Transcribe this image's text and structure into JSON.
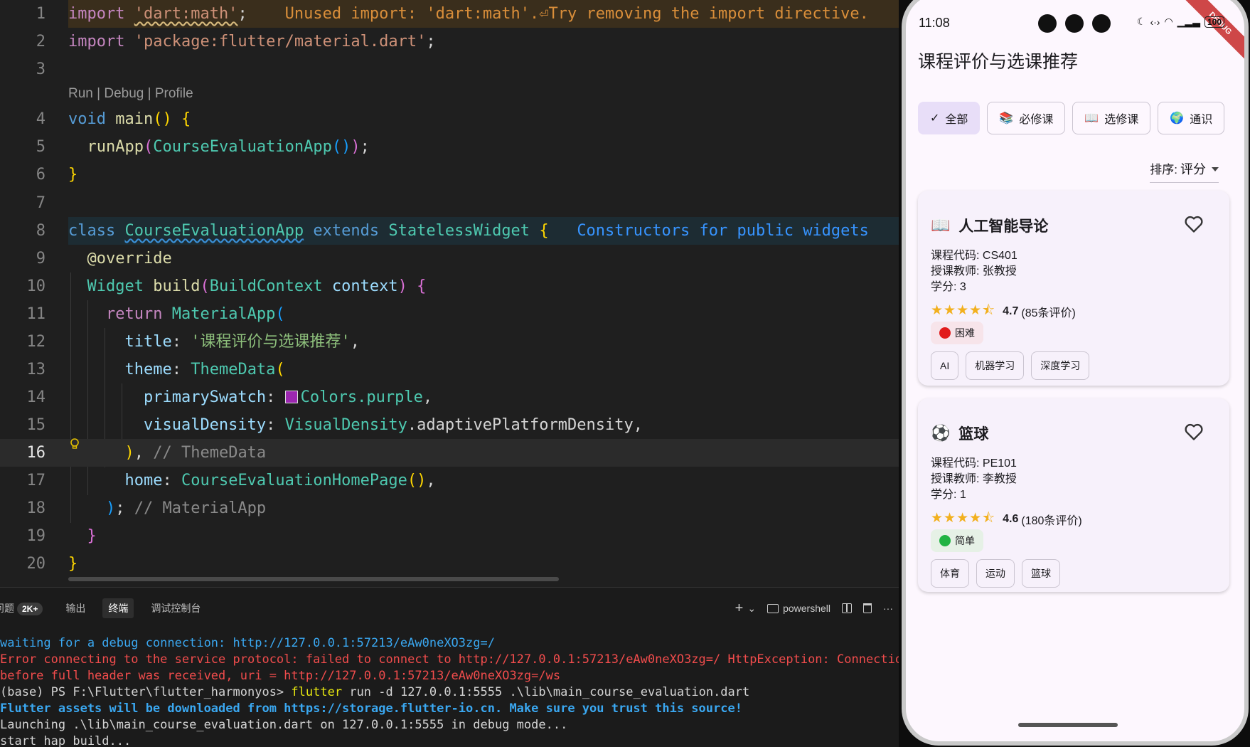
{
  "editor": {
    "lines": [
      {
        "n": "1"
      },
      {
        "n": "2"
      },
      {
        "n": "3"
      },
      {
        "n": "4"
      },
      {
        "n": "5"
      },
      {
        "n": "6"
      },
      {
        "n": "7"
      },
      {
        "n": "8"
      },
      {
        "n": "9"
      },
      {
        "n": "10"
      },
      {
        "n": "11"
      },
      {
        "n": "12"
      },
      {
        "n": "13"
      },
      {
        "n": "14"
      },
      {
        "n": "15"
      },
      {
        "n": "16"
      },
      {
        "n": "17"
      },
      {
        "n": "18"
      },
      {
        "n": "19"
      },
      {
        "n": "20"
      }
    ],
    "codelens": "Run | Debug | Profile",
    "import1_kw": "import",
    "import1_str": "'dart:math'",
    "import1_semi": ";",
    "import1_hint": "Unused import: 'dart:math'.⏎Try removing the import directive.",
    "import2_kw": "import",
    "import2_str": "'package:flutter/material.dart'",
    "import2_semi": ";",
    "main_void": "void",
    "main_name": "main",
    "runapp": "runApp",
    "app_class": "CourseEvaluationApp",
    "kw_class": "class",
    "kw_extends": "extends",
    "stateless": "StatelessWidget",
    "line8_hint": "Constructors for public widgets",
    "override": "@override",
    "widget": "Widget",
    "build": "build",
    "buildcontext": "BuildContext",
    "context": "context",
    "kw_return": "return",
    "materialapp": "MaterialApp",
    "title_prop": "title",
    "title_val": "'课程评价与选课推荐'",
    "theme_prop": "theme",
    "themedata": "ThemeData",
    "primary_prop": "primarySwatch",
    "colors_purple": "Colors.purple",
    "density_prop": "visualDensity",
    "density_cls": "VisualDensity",
    "density_val": ".adaptivePlatformDensity",
    "themedata_comment": "// ThemeData",
    "home_prop": "home",
    "homepage": "CourseEvaluationHomePage",
    "materialapp_comment": "// MaterialApp",
    "swatch_color": "#9c27b0"
  },
  "panel": {
    "tabs": [
      {
        "label": "问题",
        "badge": "2K+"
      },
      {
        "label": "输出"
      },
      {
        "label": "终端"
      },
      {
        "label": "调试控制台"
      }
    ],
    "actions": {
      "add": "+",
      "chevron": "⌄",
      "shell": "powershell",
      "more": "···"
    },
    "terminal": [
      "waiting for a debug connection: http://127.0.0.1:57213/eAw0neXO3zg=/",
      "Error connecting to the service protocol: failed to connect to http://127.0.0.1:57213/eAw0neXO3zg=/ HttpException: Connection c",
      "before full header was received, uri = http://127.0.0.1:57213/eAw0neXO3zg=/ws",
      "(base) PS F:\\Flutter\\flutter_harmonyos>",
      "flutter",
      "run -d 127.0.0.1:5555 .\\lib\\main_course_evaluation.dart",
      "Flutter assets will be downloaded from https://storage.flutter-io.cn. Make sure you trust this source!",
      "Launching .\\lib\\main_course_evaluation.dart on 127.0.0.1:5555 in debug mode...",
      "start hap build..."
    ]
  },
  "phone": {
    "status": {
      "time": "11:08",
      "battery": "100",
      "debug": "DEBUG"
    },
    "app_title": "课程评价与选课推荐",
    "chips": [
      {
        "icon": "✓",
        "label": "全部",
        "selected": true
      },
      {
        "icon": "📚",
        "label": "必修课"
      },
      {
        "icon": "📖",
        "label": "选修课"
      },
      {
        "icon": "🌍",
        "label": "通识"
      }
    ],
    "sort": {
      "label": "排序:",
      "value": "评分"
    },
    "courses": [
      {
        "icon": "📖",
        "name": "人工智能导论",
        "code": "课程代码: CS401",
        "teacher": "授课教师: 张教授",
        "credit": "学分: 3",
        "stars": "★★★★⯪",
        "rating": "4.7",
        "reviews": "(85条评价)",
        "difficulty": "困难",
        "diff_color": "#e11b1b",
        "diff_bg": "#f7e4ea",
        "tags": [
          "AI",
          "机器学习",
          "深度学习"
        ]
      },
      {
        "icon": "⚽",
        "name": "篮球",
        "code": "课程代码: PE101",
        "teacher": "授课教师: 李教授",
        "credit": "学分: 1",
        "stars": "★★★★⯪",
        "rating": "4.6",
        "reviews": "(180条评价)",
        "difficulty": "简单",
        "diff_color": "#21b343",
        "diff_bg": "#e6f1e6",
        "tags": [
          "体育",
          "运动",
          "篮球"
        ]
      }
    ]
  }
}
